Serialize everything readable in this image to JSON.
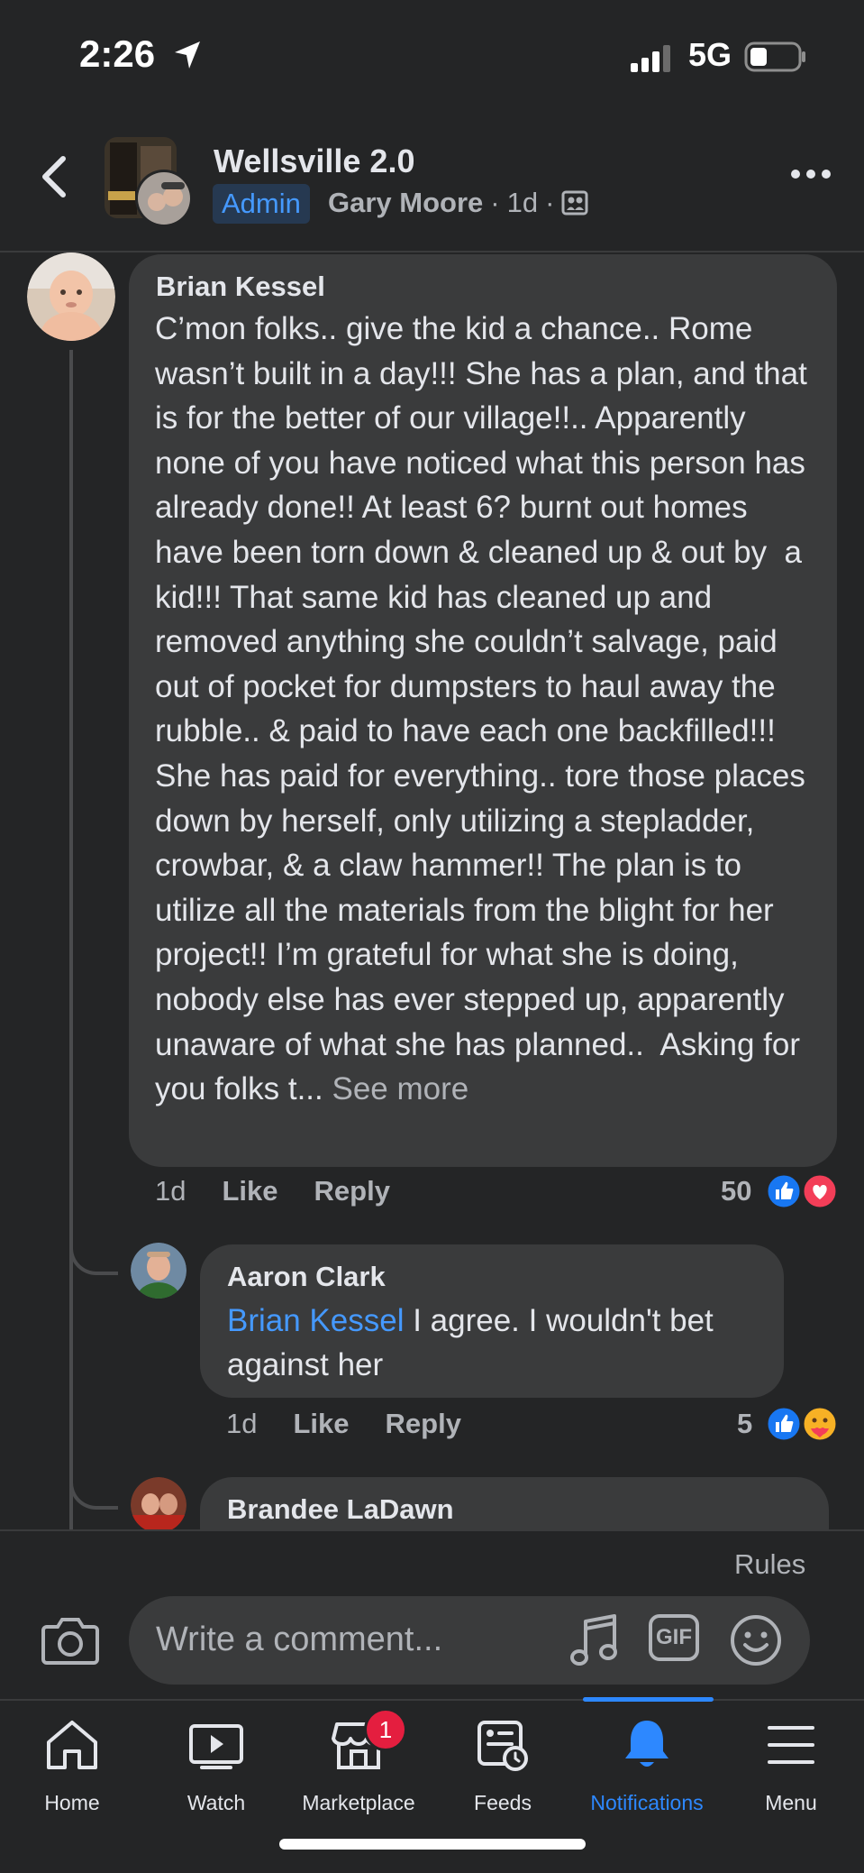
{
  "status_bar": {
    "time": "2:26",
    "network": "5G"
  },
  "header": {
    "group_name": "Wellsville 2.0",
    "admin_badge": "Admin",
    "author": "Gary Moore",
    "separator": "·",
    "age": "1d",
    "icons": [
      "back-chevron",
      "group-avatar",
      "group-privacy-icon",
      "more-dots"
    ]
  },
  "comments": [
    {
      "author": "Brian Kessel",
      "text": "C’mon folks.. give the kid a chance.. Rome wasn’t built in a day!!! She has a plan, and that is for the better of our village!!.. Apparently none of you have noticed what this person has already done!! At least 6? burnt out homes have been torn down & cleaned up & out by  a kid!!! That same kid has cleaned up and removed anything she couldn’t salvage, paid out of pocket for dumpsters to haul away the rubble.. & paid to have each one backfilled!!! She has paid for everything.. tore those places down by herself, only utilizing a stepladder, crowbar, & a claw hammer!! The plan is to utilize all the materials from the blight for her project!! I’m grateful for what she is doing, nobody else has ever stepped up, apparently unaware of what she has planned..  Asking for you folks t...",
      "see_more": "See more",
      "time": "1d",
      "like": "Like",
      "reply": "Reply",
      "reaction_count": "50",
      "reactions": [
        "like",
        "love"
      ]
    },
    {
      "author": "Aaron Clark",
      "mention": "Brian Kessel",
      "text": " I agree.  I wouldn't bet against her",
      "time": "1d",
      "like": "Like",
      "reply": "Reply",
      "reaction_count": "5",
      "reactions": [
        "like",
        "care"
      ]
    },
    {
      "author": "Brandee LaDawn"
    }
  ],
  "composer": {
    "rules": "Rules",
    "placeholder": "Write a comment...",
    "gif_label": "GIF"
  },
  "tabs": [
    {
      "label": "Home",
      "icon": "home-icon"
    },
    {
      "label": "Watch",
      "icon": "watch-icon"
    },
    {
      "label": "Marketplace",
      "icon": "marketplace-icon",
      "badge": "1"
    },
    {
      "label": "Feeds",
      "icon": "feeds-icon"
    },
    {
      "label": "Notifications",
      "icon": "bell-icon",
      "active": true
    },
    {
      "label": "Menu",
      "icon": "menu-icon"
    }
  ],
  "colors": {
    "background": "#242526",
    "bubble": "#3a3b3c",
    "accent": "#2d88ff",
    "mention": "#4599ff",
    "badge": "#e41e3f"
  }
}
